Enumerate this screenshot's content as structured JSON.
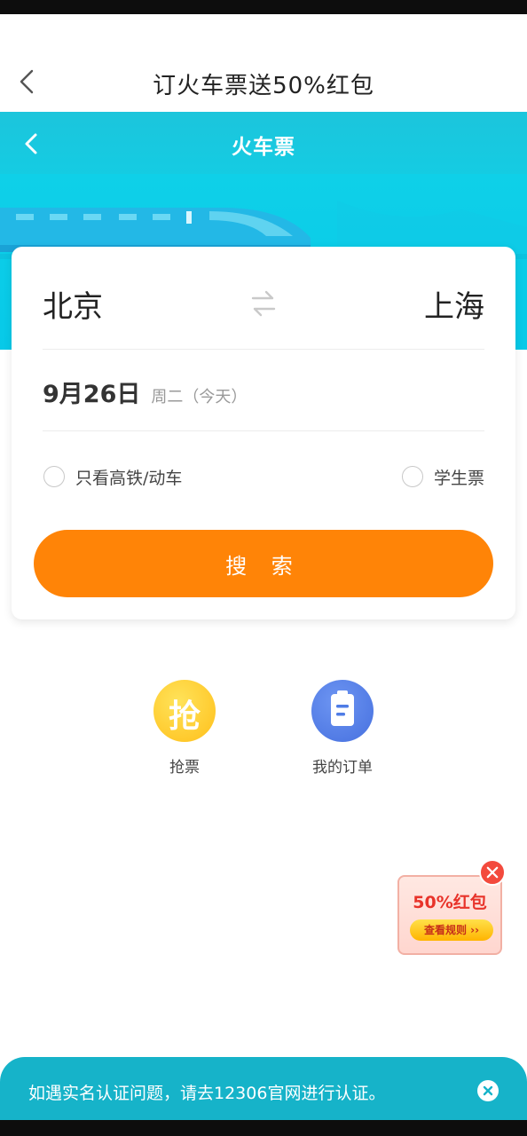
{
  "nav": {
    "title": "订火车票送50%红包"
  },
  "header": {
    "title": "火车票"
  },
  "search_form": {
    "from_city": "北京",
    "to_city": "上海",
    "date": "9月26日",
    "date_sub": "周二（今天）",
    "option_high_speed": "只看高铁/动车",
    "option_student": "学生票",
    "search_label": "搜 索"
  },
  "quick_actions": [
    {
      "label": "抢票",
      "icon": "grab-ticket-icon",
      "glyph": "抢"
    },
    {
      "label": "我的订单",
      "icon": "order-clipboard-icon"
    }
  ],
  "promo": {
    "amount_text": "50%红包",
    "rules_label": "查看规则 ››"
  },
  "notice": {
    "text": "如遇实名认证问题，请去12306官网进行认证。"
  },
  "colors": {
    "primary": "#16b3c9",
    "accent": "#ff8407",
    "grab_icon": "#ffc21a",
    "order_icon": "#4f7ce6",
    "promo_red": "#e8332a"
  }
}
